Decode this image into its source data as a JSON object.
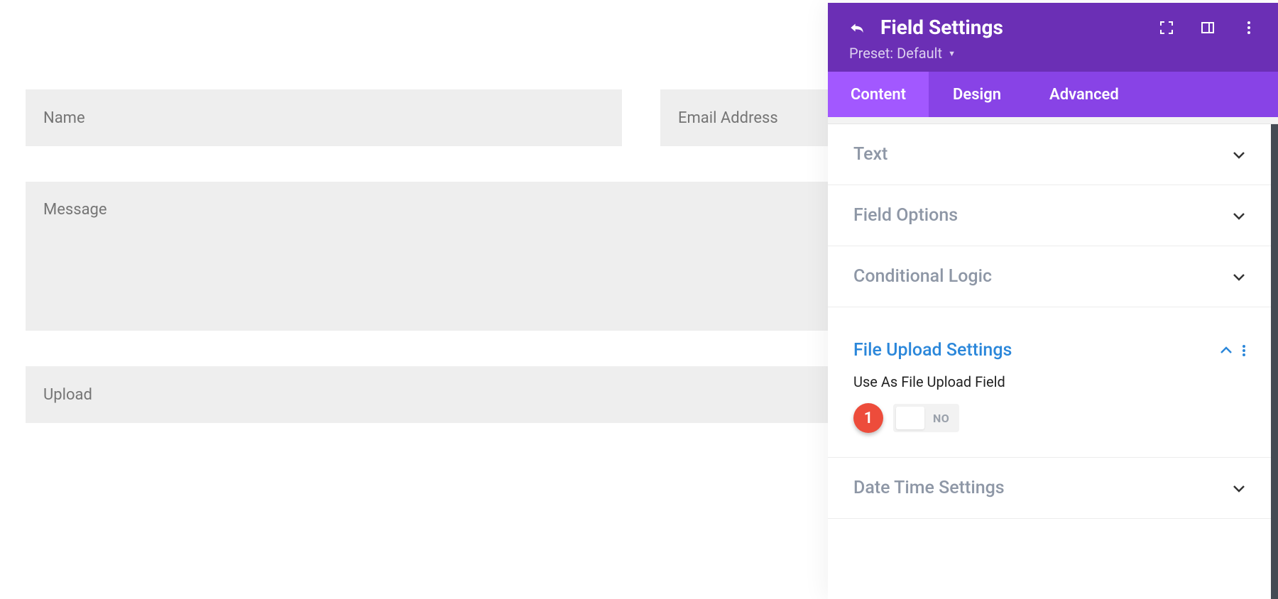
{
  "form": {
    "name_placeholder": "Name",
    "email_placeholder": "Email Address",
    "message_placeholder": "Message",
    "upload_placeholder": "Upload"
  },
  "panel": {
    "title": "Field Settings",
    "preset_label": "Preset: Default",
    "tabs": {
      "content": "Content",
      "design": "Design",
      "advanced": "Advanced"
    },
    "sections": {
      "text": "Text",
      "field_options": "Field Options",
      "conditional_logic": "Conditional Logic",
      "file_upload_settings": "File Upload Settings",
      "date_time_settings": "Date Time Settings"
    },
    "file_upload": {
      "label": "Use As File Upload Field",
      "toggle_state": "NO"
    },
    "callout": "1"
  }
}
